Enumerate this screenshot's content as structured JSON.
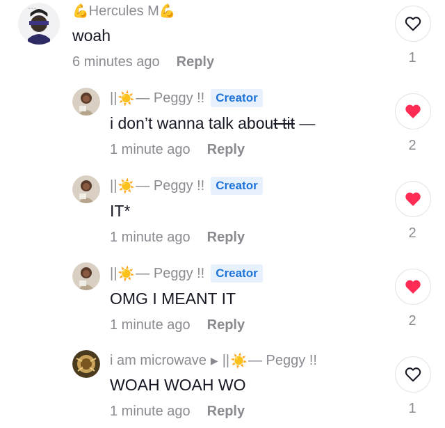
{
  "comments": [
    {
      "username_prefix_emoji": "💪",
      "username": "Hercules M",
      "username_suffix_emoji": "💪",
      "text": "woah",
      "time": "6 minutes ago",
      "reply_label": "Reply",
      "likes": "1",
      "liked": false
    },
    {
      "username_prefix": "||",
      "username_sun": "☀️",
      "username": "— Peggy !!",
      "badge": "Creator",
      "text": "i don’t wanna talk abou",
      "text_struck": "t tit",
      "text_trailing": " —",
      "time": "1 minute ago",
      "reply_label": "Reply",
      "likes": "2",
      "liked": true
    },
    {
      "username_prefix": "||",
      "username_sun": "☀️",
      "username": "— Peggy !!",
      "badge": "Creator",
      "text": "IT*",
      "time": "1 minute ago",
      "reply_label": "Reply",
      "likes": "2",
      "liked": true
    },
    {
      "username_prefix": "||",
      "username_sun": "☀️",
      "username": "— Peggy !!",
      "badge": "Creator",
      "text": "OMG I MEANT IT",
      "time": "1 minute ago",
      "reply_label": "Reply",
      "likes": "2",
      "liked": true
    },
    {
      "username": "i am microwave",
      "reply_to_arrow": "▶",
      "reply_to_prefix": "||",
      "reply_to_sun": "☀️",
      "reply_to": "— Peggy !!",
      "text": "WOAH WOAH WO",
      "time": "1 minute ago",
      "reply_label": "Reply",
      "likes": "1",
      "liked": false
    }
  ],
  "colors": {
    "like_red": "#fe2c55",
    "badge_bg": "#e6f1fd",
    "badge_text": "#1e73d8",
    "meta_gray": "#8a8b91"
  }
}
